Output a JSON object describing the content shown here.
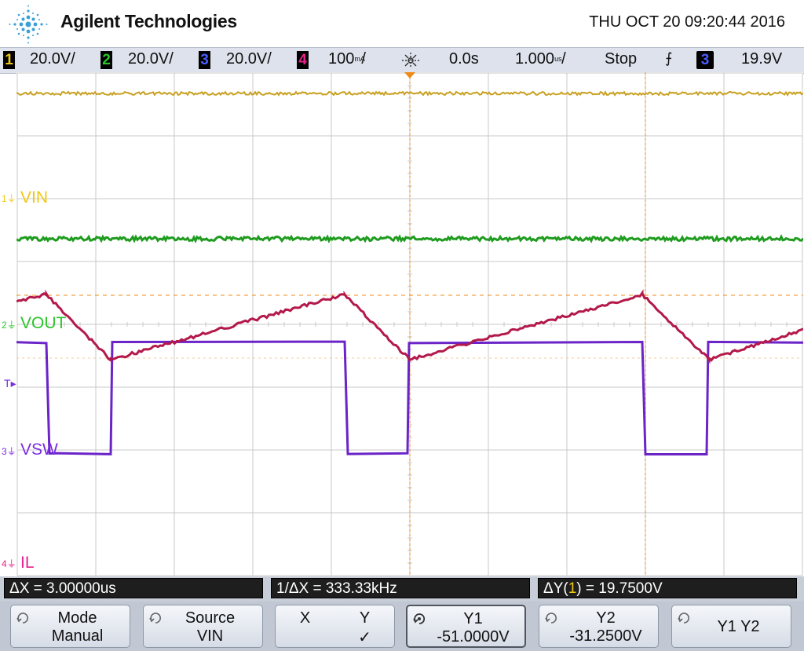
{
  "header": {
    "brand": "Agilent Technologies",
    "datetime": "THU OCT 20 09:20:44 2016"
  },
  "status_bar": {
    "channels": [
      {
        "num": "1",
        "scale": "20.0V/",
        "color": "#f0c814"
      },
      {
        "num": "2",
        "scale": "20.0V/",
        "color": "#29c629"
      },
      {
        "num": "3",
        "scale": "20.0V/",
        "color": "#4a5cff"
      },
      {
        "num": "4",
        "scale": "100",
        "unit": "mA",
        "per": "/",
        "color": "#e8208a"
      }
    ],
    "trigger_delay": "0.0s",
    "timebase": "1.000",
    "timebase_unit": "us",
    "timebase_per": "/",
    "run_state": "Stop",
    "trigger_slope_symbol": "⨍",
    "trigger_source": "3",
    "trigger_level": "19.9V"
  },
  "screen": {
    "labels": {
      "ch1": "VIN",
      "ch2": "VOUT",
      "ch3": "VSW",
      "ch4": "IL",
      "trig": "T"
    },
    "markers": {
      "ch1": "1",
      "ch2": "2",
      "ch3": "3",
      "ch4": "4"
    }
  },
  "measurements": {
    "dx": "ΔX = 3.00000us",
    "inv_dx": "1/ΔX = 333.33kHz",
    "dy_prefix": "ΔY(",
    "dy_source": "1",
    "dy_suffix": ") = 19.7500V"
  },
  "softkeys": [
    {
      "line1": "Mode",
      "line2": "Manual"
    },
    {
      "line1": "Source",
      "line2": "VIN"
    },
    {
      "line1": "X",
      "line1b": "Y",
      "line2": "✓"
    },
    {
      "line1": "Y1",
      "line2": "-51.0000V"
    },
    {
      "line1": "Y2",
      "line2": "-31.2500V"
    },
    {
      "line1": "Y1 Y2",
      "line2": ""
    }
  ],
  "colors": {
    "ch1": "#f0c814",
    "ch1_trace": "#c8a020",
    "ch2": "#29c629",
    "ch2_trace": "#1f9c1f",
    "ch3": "#7b2de0",
    "ch3_trace": "#6a24c8",
    "ch4": "#e8208a",
    "ch4_trace": "#b3194a",
    "cursor": "#f08a16",
    "grid": "#c9c9c9"
  }
}
